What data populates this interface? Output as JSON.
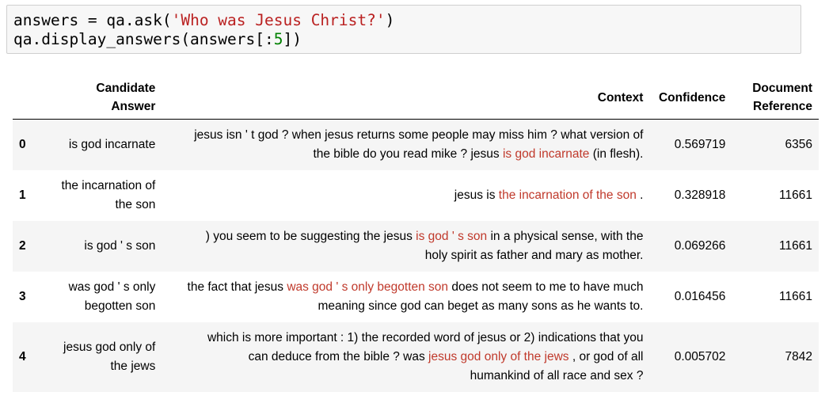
{
  "code": {
    "line1_prefix": "answers = qa.ask(",
    "line1_string": "'Who was Jesus Christ?'",
    "line1_suffix": ")",
    "line2_prefix": "qa.display_answers(answers[:",
    "line2_number": "5",
    "line2_suffix": "])"
  },
  "table": {
    "headers": {
      "index": "",
      "candidate_answer_1": "Candidate",
      "candidate_answer_2": "Answer",
      "context": "Context",
      "confidence": "Confidence",
      "document_reference_1": "Document",
      "document_reference_2": "Reference"
    },
    "rows": [
      {
        "index": "0",
        "answer_1": "is god incarnate",
        "answer_2": "",
        "context_line1": "jesus isn ' t god ? when jesus returns some people may miss him ? what version of",
        "context_line2_pre": "the bible do you read mike ? jesus ",
        "context_highlight": "is god incarnate",
        "context_line2_post": " (in flesh).",
        "confidence": "0.569719",
        "doc_ref": "6356"
      },
      {
        "index": "1",
        "answer_1": "the incarnation of",
        "answer_2": "the son",
        "context_pre": "jesus is ",
        "context_highlight": "the incarnation of the son",
        "context_post": " .",
        "confidence": "0.328918",
        "doc_ref": "11661"
      },
      {
        "index": "2",
        "answer_1": "is god ' s son",
        "context_line1_pre": ") you seem to be suggesting the jesus ",
        "context_highlight": "is god ' s son",
        "context_line1_post": " in a physical sense, with the",
        "context_line2": "holy spirit as father and mary as mother.",
        "confidence": "0.069266",
        "doc_ref": "11661"
      },
      {
        "index": "3",
        "answer_1": "was god ' s only",
        "answer_2": "begotten son",
        "context_line1_pre": "the fact that jesus ",
        "context_highlight": "was god ' s only begotten son",
        "context_line1_post": " does not seem to me to have much",
        "context_line2": "meaning since god can beget as many sons as he wants to.",
        "confidence": "0.016456",
        "doc_ref": "11661"
      },
      {
        "index": "4",
        "answer_1": "jesus god only of",
        "answer_2": "the jews",
        "context_line1": "which is more important : 1) the recorded word of jesus or 2) indications that you",
        "context_line2_pre": "can deduce from the bible ? was ",
        "context_highlight": "jesus god only of the jews",
        "context_line2_post": " , or god of all",
        "context_line3": "humankind of all race and sex ?",
        "confidence": "0.005702",
        "doc_ref": "7842"
      }
    ]
  },
  "colors": {
    "highlight": "#c0392b",
    "code_string": "#ba2121",
    "code_number": "#008000",
    "code_cell_bg": "#f7f7f7",
    "row_stripe": "#f5f5f5"
  }
}
